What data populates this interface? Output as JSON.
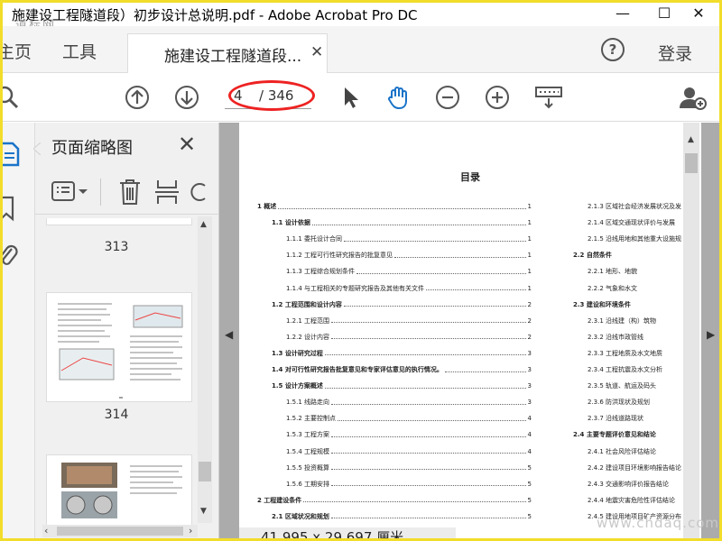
{
  "window": {
    "title": "施建设工程隧道段）初步设计总说明.pdf - Adobe Acrobat Pro DC",
    "minimize": "—",
    "maximize": "☐",
    "close": "✕"
  },
  "watermarks": {
    "top_left": "道标网",
    "bottom_right": "www.chdaq.com"
  },
  "tabs": {
    "home": "主页",
    "tools": "工具",
    "document": "施建设工程隧道段...",
    "document_close": "✕",
    "help": "?",
    "login": "登录"
  },
  "toolbar": {
    "current_page": "4",
    "total_pages": "/ 346"
  },
  "thumbnails": {
    "title": "页面缩略图",
    "close": "✕",
    "pages": [
      "313",
      "314"
    ],
    "dash": "-"
  },
  "document": {
    "toc_title": "目录",
    "size_info": "41.995 x 29.697 厘米",
    "toc_left": [
      {
        "text": "1 概述",
        "page": "1",
        "level": 0,
        "bold": true
      },
      {
        "text": "1.1 设计依据",
        "page": "1",
        "level": 1,
        "bold": true
      },
      {
        "text": "1.1.1 委托设计合同",
        "page": "1",
        "level": 2,
        "bold": false
      },
      {
        "text": "1.1.2 工程可行性研究报告的批复意见",
        "page": "1",
        "level": 2,
        "bold": false
      },
      {
        "text": "1.1.3 工程综合规划条件",
        "page": "1",
        "level": 2,
        "bold": false
      },
      {
        "text": "1.1.4 与工程相关的专题研究报告及其他有关文件",
        "page": "1",
        "level": 2,
        "bold": false
      },
      {
        "text": "1.2 工程范围和设计内容",
        "page": "2",
        "level": 1,
        "bold": true
      },
      {
        "text": "1.2.1 工程范围",
        "page": "2",
        "level": 2,
        "bold": false
      },
      {
        "text": "1.2.2 设计内容",
        "page": "2",
        "level": 2,
        "bold": false
      },
      {
        "text": "1.3 设计研究过程",
        "page": "3",
        "level": 1,
        "bold": true
      },
      {
        "text": "1.4 对可行性研究报告批复意见和专家评估意见的执行情况。",
        "page": "3",
        "level": 1,
        "bold": true
      },
      {
        "text": "1.5 设计方案概述",
        "page": "3",
        "level": 1,
        "bold": true
      },
      {
        "text": "1.5.1 线路走向",
        "page": "3",
        "level": 2,
        "bold": false
      },
      {
        "text": "1.5.2 主要控制点",
        "page": "4",
        "level": 2,
        "bold": false
      },
      {
        "text": "1.5.3 工程方案",
        "page": "4",
        "level": 2,
        "bold": false
      },
      {
        "text": "1.5.4 工程规模",
        "page": "4",
        "level": 2,
        "bold": false
      },
      {
        "text": "1.5.5 投资概算",
        "page": "5",
        "level": 2,
        "bold": false
      },
      {
        "text": "1.5.6 工期安排",
        "page": "5",
        "level": 2,
        "bold": false
      },
      {
        "text": "2 工程建设条件",
        "page": "5",
        "level": 0,
        "bold": true
      },
      {
        "text": "2.1 区域状况和规划",
        "page": "5",
        "level": 1,
        "bold": true
      }
    ],
    "toc_right": [
      {
        "text": "2.1.3 区域社会经济发展状况及发",
        "level": 2
      },
      {
        "text": "2.1.4 区域交通现状评价与发展",
        "level": 2
      },
      {
        "text": "2.1.5 沿线用地和其他重大设施规",
        "level": 2
      },
      {
        "text": "2.2 自然条件",
        "level": 1
      },
      {
        "text": "2.2.1 地形、地貌",
        "level": 2
      },
      {
        "text": "2.2.2 气象和水文",
        "level": 2
      },
      {
        "text": "2.3 建设和环境条件",
        "level": 1
      },
      {
        "text": "2.3.1 沿线建（构）筑物",
        "level": 2
      },
      {
        "text": "2.3.2 沿线市政管线",
        "level": 2
      },
      {
        "text": "2.3.3 工程地质及水文地质",
        "level": 2
      },
      {
        "text": "2.3.4 工程抗震及水文分析",
        "level": 2
      },
      {
        "text": "2.3.5 轨道、航运及码头",
        "level": 2
      },
      {
        "text": "2.3.6 防洪现状及规划",
        "level": 2
      },
      {
        "text": "2.3.7 沿线道路现状",
        "level": 2
      },
      {
        "text": "2.4 主要专题评价意见和结论",
        "level": 1
      },
      {
        "text": "2.4.1 社会风险评估结论",
        "level": 2
      },
      {
        "text": "2.4.2 建设项目环境影响报告结论",
        "level": 2
      },
      {
        "text": "2.4.3 交通影响评价报告结论",
        "level": 2
      },
      {
        "text": "2.4.4 地震灾害危险性评估结论",
        "level": 2
      },
      {
        "text": "2.4.5 建设用地项目矿产资源分布",
        "level": 2
      }
    ]
  }
}
